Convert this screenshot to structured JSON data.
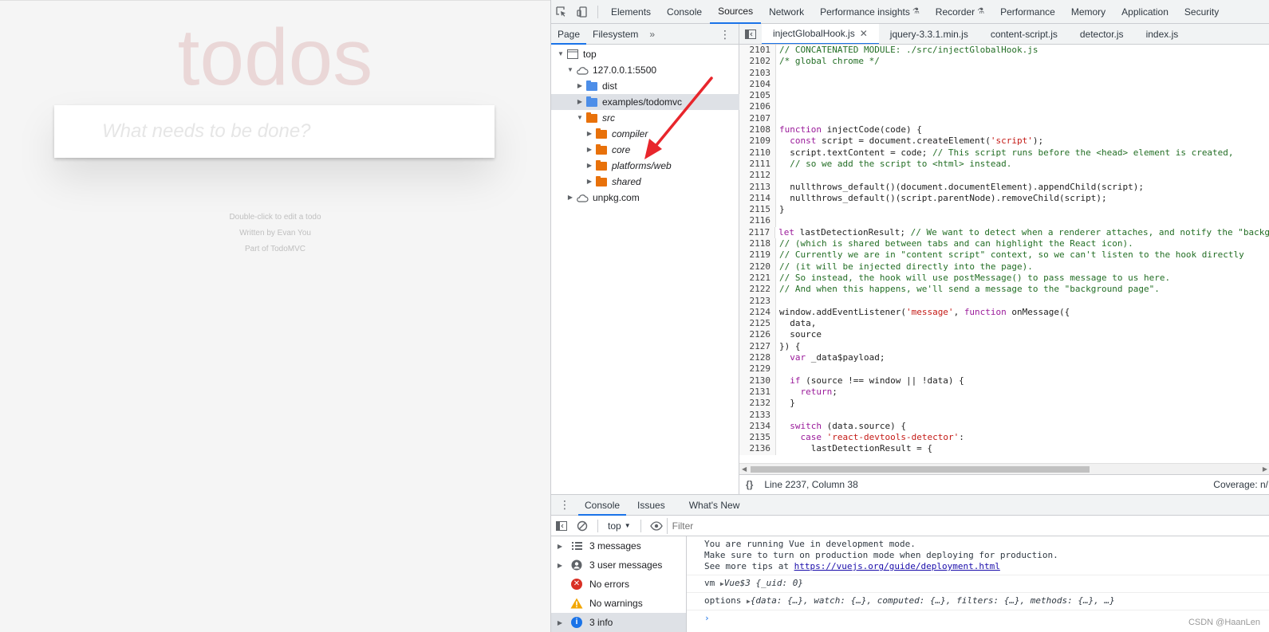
{
  "todo": {
    "title": "todos",
    "placeholder": "What needs to be done?",
    "info": [
      "Double-click to edit a todo",
      "Written by Evan You",
      "Part of TodoMVC"
    ]
  },
  "devtools": {
    "main_tabs": [
      "Elements",
      "Console",
      "Sources",
      "Network",
      "Performance insights",
      "Recorder",
      "Performance",
      "Memory",
      "Application",
      "Security"
    ],
    "active_main_tab": "Sources",
    "navigator": {
      "tabs": [
        "Page",
        "Filesystem"
      ],
      "tree": [
        {
          "label": "top",
          "depth": 0,
          "kind": "frame",
          "open": true
        },
        {
          "label": "127.0.0.1:5500",
          "depth": 1,
          "kind": "cloud",
          "open": true
        },
        {
          "label": "dist",
          "depth": 2,
          "kind": "folder-blue",
          "open": false
        },
        {
          "label": "examples/todomvc",
          "depth": 2,
          "kind": "folder-blue",
          "open": false,
          "selected": true
        },
        {
          "label": "src",
          "depth": 2,
          "kind": "folder-orange",
          "open": true,
          "italic": true
        },
        {
          "label": "compiler",
          "depth": 3,
          "kind": "folder-orange",
          "open": false,
          "italic": true
        },
        {
          "label": "core",
          "depth": 3,
          "kind": "folder-orange",
          "open": false,
          "italic": true
        },
        {
          "label": "platforms/web",
          "depth": 3,
          "kind": "folder-orange",
          "open": false,
          "italic": true
        },
        {
          "label": "shared",
          "depth": 3,
          "kind": "folder-orange",
          "open": false,
          "italic": true
        },
        {
          "label": "unpkg.com",
          "depth": 1,
          "kind": "cloud",
          "open": false
        }
      ]
    },
    "editor": {
      "tabs": [
        "injectGlobalHook.js",
        "jquery-3.3.1.min.js",
        "content-script.js",
        "detector.js",
        "index.js"
      ],
      "active_tab": "injectGlobalHook.js",
      "lines": [
        {
          "n": "2101",
          "t": "// CONCATENATED MODULE: ./src/injectGlobalHook.js"
        },
        {
          "n": "2102",
          "t": "/* global chrome */"
        },
        {
          "n": "2103",
          "t": ""
        },
        {
          "n": "2104",
          "t": ""
        },
        {
          "n": "2105",
          "t": ""
        },
        {
          "n": "2106",
          "t": ""
        },
        {
          "n": "2107",
          "t": ""
        },
        {
          "n": "2108",
          "t": "function injectCode(code) {"
        },
        {
          "n": "2109",
          "t": "  const script = document.createElement('script');"
        },
        {
          "n": "2110",
          "t": "  script.textContent = code; // This script runs before the <head> element is created,"
        },
        {
          "n": "2111",
          "t": "  // so we add the script to <html> instead."
        },
        {
          "n": "2112",
          "t": ""
        },
        {
          "n": "2113",
          "t": "  nullthrows_default()(document.documentElement).appendChild(script);"
        },
        {
          "n": "2114",
          "t": "  nullthrows_default()(script.parentNode).removeChild(script);"
        },
        {
          "n": "2115",
          "t": "}"
        },
        {
          "n": "2116",
          "t": ""
        },
        {
          "n": "2117",
          "t": "let lastDetectionResult; // We want to detect when a renderer attaches, and notify the \"backg"
        },
        {
          "n": "2118",
          "t": "// (which is shared between tabs and can highlight the React icon)."
        },
        {
          "n": "2119",
          "t": "// Currently we are in \"content script\" context, so we can't listen to the hook directly"
        },
        {
          "n": "2120",
          "t": "// (it will be injected directly into the page)."
        },
        {
          "n": "2121",
          "t": "// So instead, the hook will use postMessage() to pass message to us here."
        },
        {
          "n": "2122",
          "t": "// And when this happens, we'll send a message to the \"background page\"."
        },
        {
          "n": "2123",
          "t": ""
        },
        {
          "n": "2124",
          "t": "window.addEventListener('message', function onMessage({"
        },
        {
          "n": "2125",
          "t": "  data,"
        },
        {
          "n": "2126",
          "t": "  source"
        },
        {
          "n": "2127",
          "t": "}) {"
        },
        {
          "n": "2128",
          "t": "  var _data$payload;"
        },
        {
          "n": "2129",
          "t": ""
        },
        {
          "n": "2130",
          "t": "  if (source !== window || !data) {"
        },
        {
          "n": "2131",
          "t": "    return;"
        },
        {
          "n": "2132",
          "t": "  }"
        },
        {
          "n": "2133",
          "t": ""
        },
        {
          "n": "2134",
          "t": "  switch (data.source) {"
        },
        {
          "n": "2135",
          "t": "    case 'react-devtools-detector':"
        },
        {
          "n": "2136",
          "t": "      lastDetectionResult = {"
        }
      ],
      "status_position": "Line 2237, Column 38",
      "status_coverage": "Coverage: n/"
    },
    "drawer": {
      "tabs": [
        "Console",
        "Issues",
        "What's New"
      ],
      "active_tab": "Console",
      "context": "top",
      "filter_placeholder": "Filter",
      "sidebar": [
        {
          "label": "3 messages",
          "icon": "list-icon"
        },
        {
          "label": "3 user messages",
          "icon": "user-icon"
        },
        {
          "label": "No errors",
          "icon": "error-icon"
        },
        {
          "label": "No warnings",
          "icon": "warning-icon"
        },
        {
          "label": "3 info",
          "icon": "info-icon",
          "selected": true
        }
      ],
      "messages": {
        "vue_line1": "You are running Vue in development mode.",
        "vue_line2": "Make sure to turn on production mode when deploying for production.",
        "vue_line3_prefix": "See more tips at ",
        "vue_link": "https://vuejs.org/guide/deployment.html",
        "vm_label": "vm",
        "vm_value": "Vue$3 {_uid: 0}",
        "options_label": "options",
        "options_value": "{data: {…}, watch: {…}, computed: {…}, filters: {…}, methods: {…}, …}"
      },
      "prompt": "›"
    },
    "watermark": "CSDN @HaanLen"
  },
  "colors": {
    "accent": "#1a73e8",
    "arrow": "#e8262c",
    "error": "#d93025",
    "warning": "#f2a600",
    "info": "#1a73e8"
  }
}
